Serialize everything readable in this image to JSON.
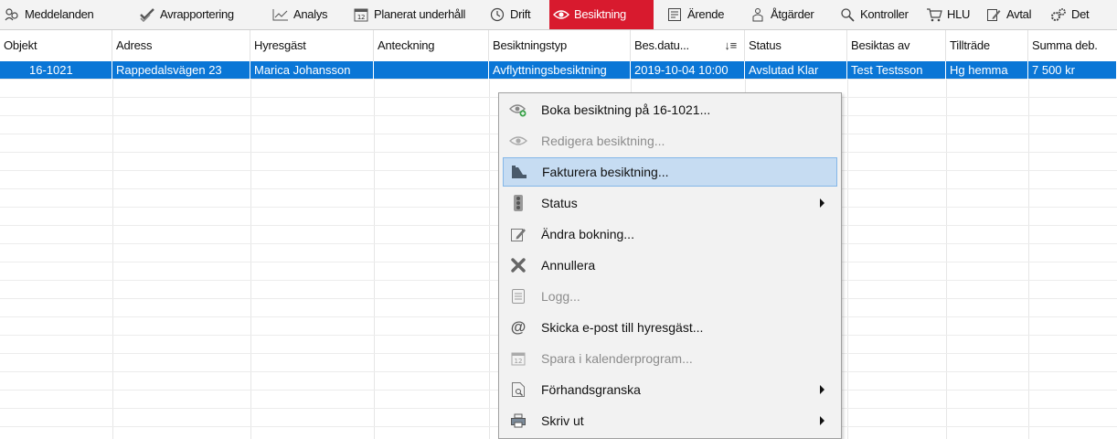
{
  "tabs": [
    {
      "label": "Meddelanden",
      "icon": "people-icon"
    },
    {
      "label": "Avrapportering",
      "icon": "check-icon"
    },
    {
      "label": "Analys",
      "icon": "chart-icon"
    },
    {
      "label": "Planerat underhåll",
      "icon": "calendar-icon"
    },
    {
      "label": "Drift",
      "icon": "clock-icon"
    },
    {
      "label": "Besiktning",
      "icon": "eye-icon",
      "active": true
    },
    {
      "label": "Ärende",
      "icon": "form-icon"
    },
    {
      "label": "Åtgärder",
      "icon": "worker-icon"
    },
    {
      "label": "Kontroller",
      "icon": "magnifier-icon"
    },
    {
      "label": "HLU",
      "icon": "cart-icon"
    },
    {
      "label": "Avtal",
      "icon": "contract-icon"
    },
    {
      "label": "Det",
      "icon": "gears-icon"
    }
  ],
  "columns": [
    "Objekt",
    "Adress",
    "Hyresgäst",
    "Anteckning",
    "Besiktningstyp",
    "Bes.datu...",
    "Status",
    "Besiktas av",
    "Tillträde",
    "Summa deb."
  ],
  "rows": [
    {
      "objekt": "16-1021",
      "adress": "Rappedalsvägen 23",
      "hyresgast": "Marica Johansson",
      "anteckning": "",
      "besiktningstyp": "Avflyttningsbesiktning",
      "besdatum": "2019-10-04 10:00",
      "status": "Avslutad Klar",
      "besiktas_av": "Test Testsson",
      "tilltrade": "Hg hemma",
      "summa": "7 500 kr"
    }
  ],
  "context_menu": {
    "items": [
      {
        "label": "Boka besiktning på 16-1021...",
        "icon": "eye-add-icon"
      },
      {
        "label": "Redigera besiktning...",
        "icon": "eye-icon",
        "disabled": true
      },
      {
        "label": "Fakturera besiktning...",
        "icon": "invoice-icon",
        "highlighted": true
      },
      {
        "label": "Status",
        "icon": "traffic-light-icon",
        "submenu": true
      },
      {
        "label": "Ändra bokning...",
        "icon": "edit-icon"
      },
      {
        "label": "Annullera",
        "icon": "cross-icon"
      },
      {
        "label": "Logg...",
        "icon": "log-icon",
        "disabled": true
      },
      {
        "label": "Skicka e-post till hyresgäst...",
        "icon": "at-icon"
      },
      {
        "label": "Spara i kalenderprogram...",
        "icon": "calendar-icon",
        "disabled": true
      },
      {
        "label": "Förhandsgranska",
        "icon": "preview-icon",
        "submenu": true
      },
      {
        "label": "Skriv ut",
        "icon": "printer-icon",
        "submenu": true
      }
    ]
  },
  "colors": {
    "active_tab": "#d81a2e",
    "selection": "#0a76d6",
    "menu_highlight": "#c6dcf2"
  }
}
